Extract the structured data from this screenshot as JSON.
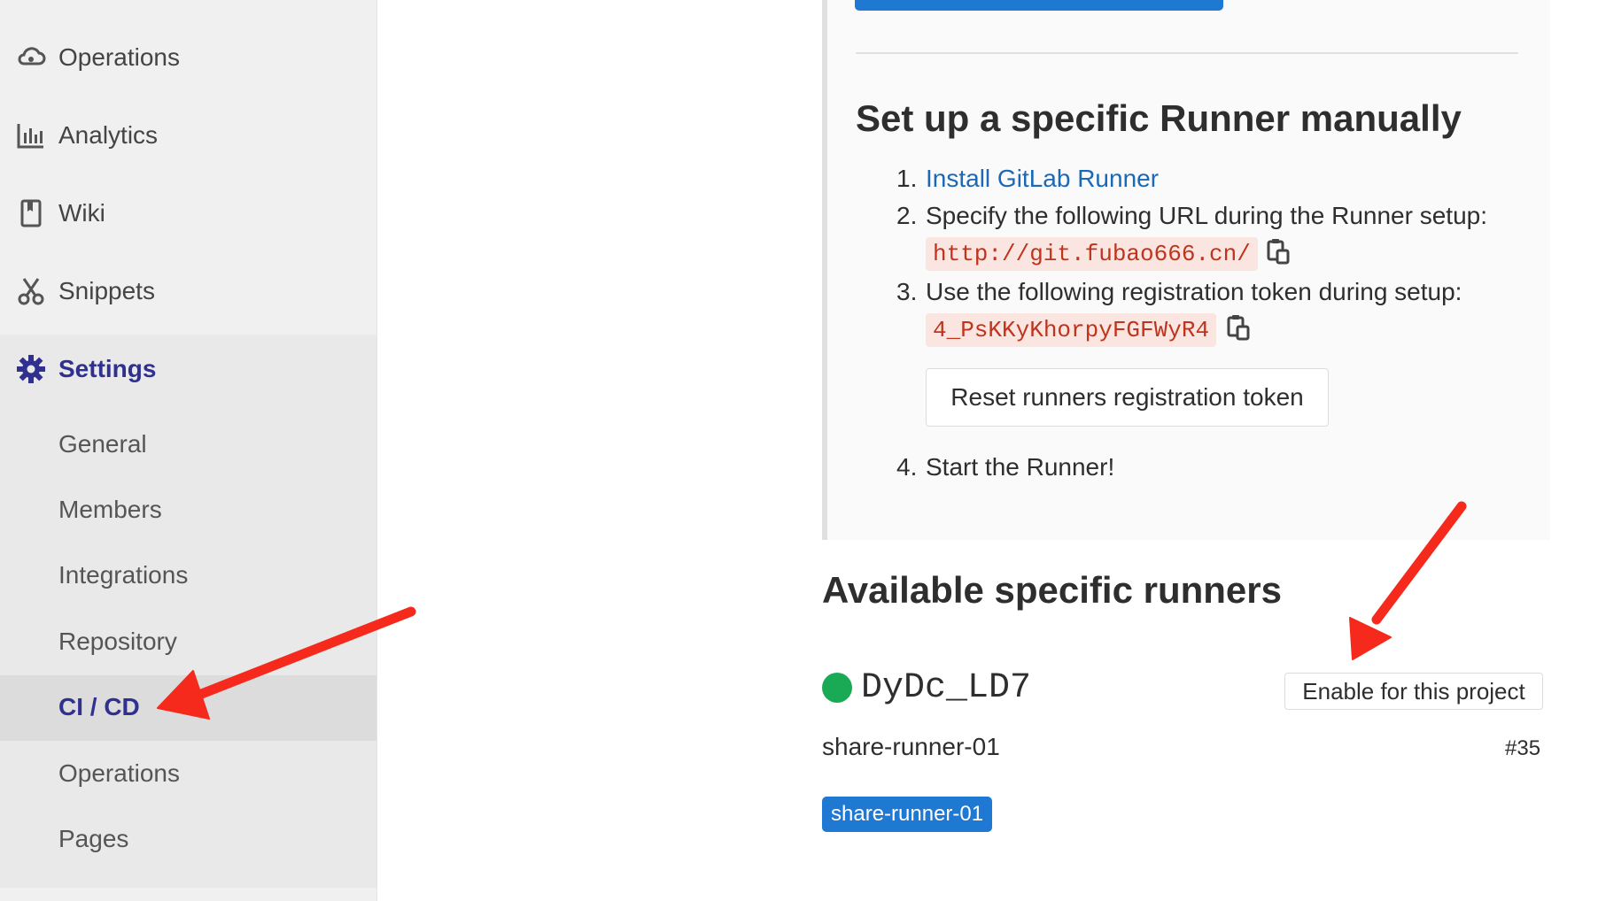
{
  "sidebar": {
    "items": [
      {
        "label": "Operations",
        "icon": "cloud-gear-icon"
      },
      {
        "label": "Analytics",
        "icon": "bar-chart-icon"
      },
      {
        "label": "Wiki",
        "icon": "book-icon"
      },
      {
        "label": "Snippets",
        "icon": "scissors-icon"
      }
    ],
    "settings": {
      "label": "Settings",
      "icon": "gear-icon"
    },
    "sub_items": [
      {
        "label": "General"
      },
      {
        "label": "Members"
      },
      {
        "label": "Integrations"
      },
      {
        "label": "Repository"
      },
      {
        "label": "CI / CD",
        "active": true
      },
      {
        "label": "Operations"
      },
      {
        "label": "Pages"
      }
    ]
  },
  "setup": {
    "title": "Set up a specific Runner manually",
    "step1_num": "1.",
    "step1_link": "Install GitLab Runner",
    "step2_num": "2.",
    "step2_text": "Specify the following URL during the Runner setup:",
    "url": "http://git.fubao666.cn/",
    "step3_num": "3.",
    "step3_text": "Use the following registration token during setup:",
    "token": "4_PsKKyKhorpyFGFWyR4",
    "reset_button": "Reset runners registration token",
    "step4_num": "4.",
    "step4_text": "Start the Runner!"
  },
  "available": {
    "title": "Available specific runners",
    "runner": {
      "name": "DyDc_LD7",
      "status_color": "#1aaa55",
      "description": "share-runner-01",
      "id": "#35",
      "tag": "share-runner-01",
      "enable_button": "Enable for this project"
    }
  },
  "colors": {
    "accent": "#1f78d1",
    "active_nav": "#303090",
    "code_text": "#c0341d",
    "annotation_arrow": "#f5291c"
  }
}
